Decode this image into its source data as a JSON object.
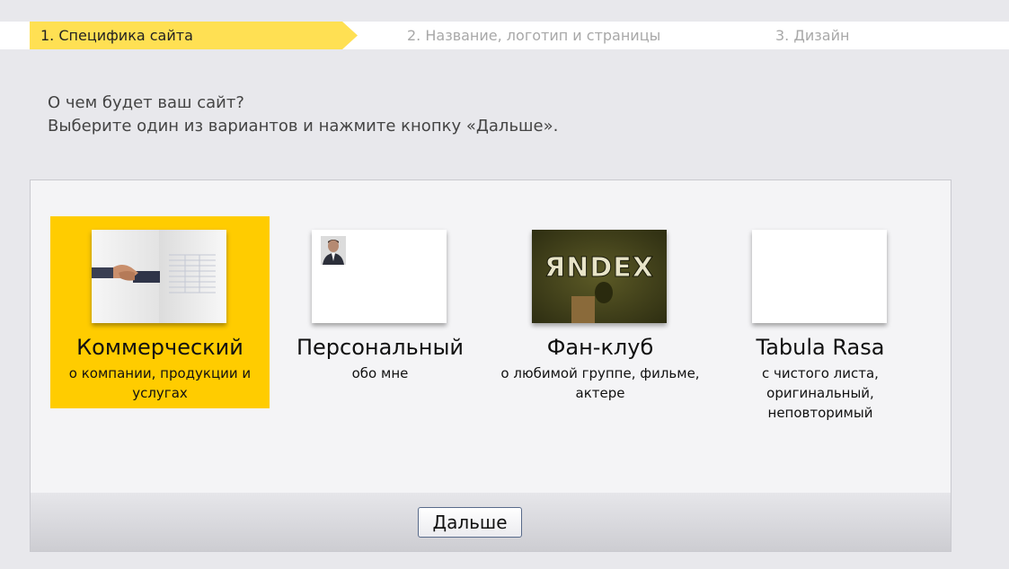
{
  "steps": [
    {
      "label": "1. Специфика сайта",
      "active": true
    },
    {
      "label": "2. Название, логотип и страницы",
      "active": false
    },
    {
      "label": "3. Дизайн",
      "active": false
    }
  ],
  "intro": {
    "question": "О чем будет ваш сайт?",
    "instruction": "Выберите один из вариантов и нажмите кнопку «Дальше»."
  },
  "options": [
    {
      "title": "Коммерческий",
      "desc": "о компании, продукции и услугах",
      "selected": true,
      "thumb_icon": "handshake-icon"
    },
    {
      "title": "Персональный",
      "desc": "обо мне",
      "selected": false,
      "thumb_icon": "portrait-photo-icon"
    },
    {
      "title": "Фан-клуб",
      "desc": "о любимой группе, фильме, актере",
      "selected": false,
      "thumb_icon": "band-logo-image",
      "thumb_text": "ЯNDEX"
    },
    {
      "title": "Tabula Rasa",
      "desc": "с чистого листа, оригинальный, неповторимый",
      "selected": false,
      "thumb_icon": "blank-page-icon"
    }
  ],
  "next_button": {
    "label": "Дальше"
  },
  "colors": {
    "active_step": "#ffe053",
    "selected_option": "#ffcc00",
    "inactive_step_text": "#a8a8a8"
  }
}
